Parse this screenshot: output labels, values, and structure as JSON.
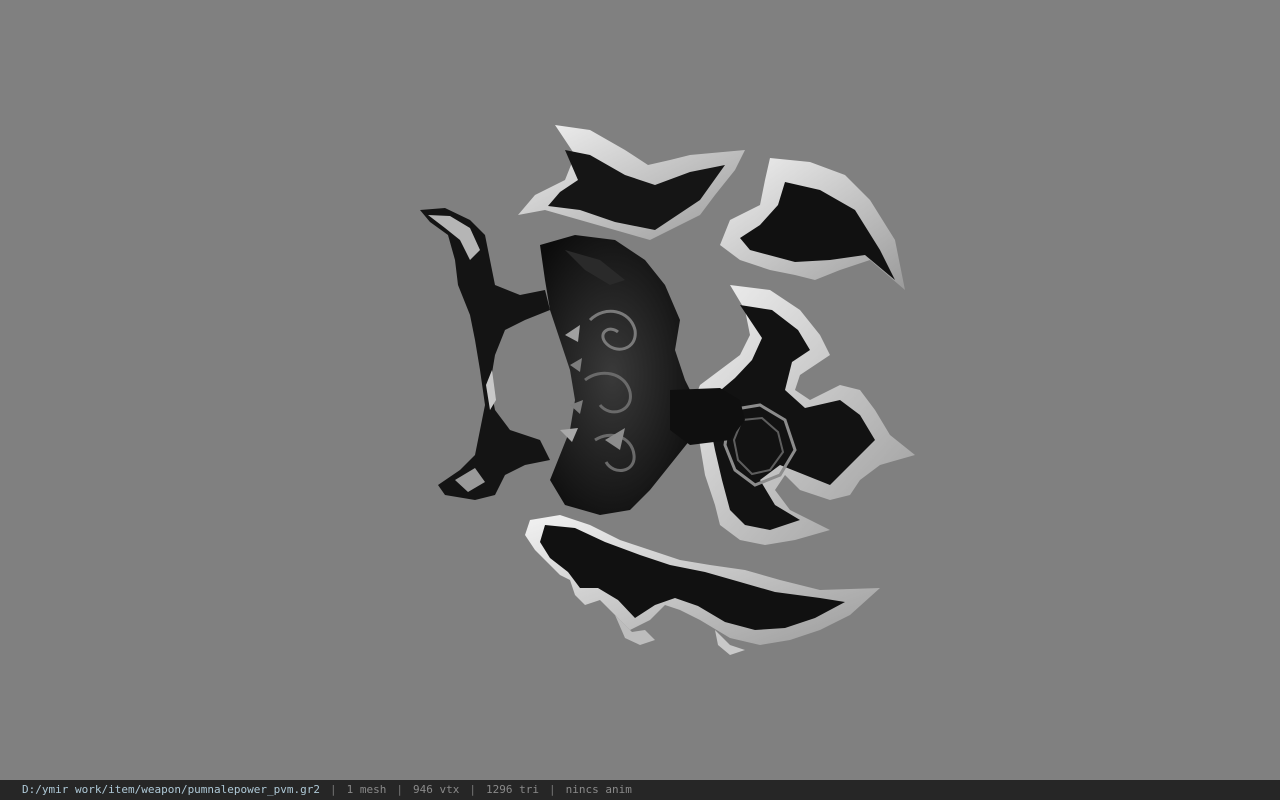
{
  "viewer": {
    "background_color": "#808080",
    "model_icon": "ornate-dagger-weapon-model"
  },
  "status_bar": {
    "file_path": "D:/ymir work/item/weapon/pumnalepower_pvm.gr2",
    "separator": "|",
    "mesh_count": "1 mesh",
    "vertex_count": "946 vtx",
    "triangle_count": "1296 tri",
    "anim_status": "nincs anim"
  }
}
